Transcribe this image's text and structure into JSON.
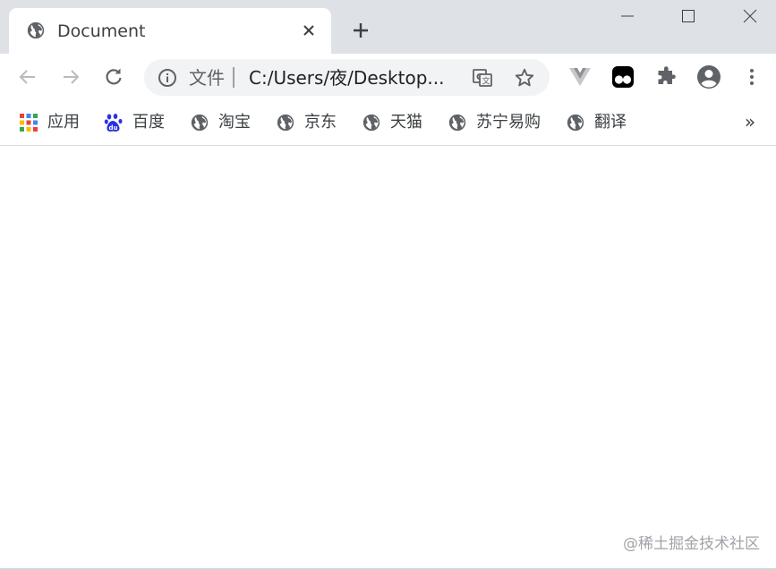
{
  "tab": {
    "title": "Document",
    "favicon": "globe-icon",
    "close_icon": "close-icon"
  },
  "new_tab_icon": "plus-icon",
  "window_controls": [
    "minimize-icon",
    "maximize-icon",
    "close-icon"
  ],
  "toolbar": {
    "back_icon": "back-arrow-icon",
    "forward_icon": "forward-arrow-icon",
    "reload_icon": "reload-icon",
    "extensions": [
      "vue-devtools-icon",
      "tampermonkey-icon",
      "puzzle-icon"
    ],
    "profile_icon": "account-icon",
    "menu_icon": "kebab-menu-icon"
  },
  "omnibox": {
    "scheme_label": "文件",
    "url": "C:/Users/夜/Desktop...",
    "info_icon": "info-icon",
    "translate_icon": "translate-icon",
    "bookmark_icon": "star-icon"
  },
  "bookmarks": [
    {
      "label": "应用",
      "icon": "apps-grid-icon"
    },
    {
      "label": "百度",
      "icon": "baidu-paw-icon"
    },
    {
      "label": "淘宝",
      "icon": "globe-icon"
    },
    {
      "label": "京东",
      "icon": "globe-icon"
    },
    {
      "label": "天猫",
      "icon": "globe-icon"
    },
    {
      "label": "苏宁易购",
      "icon": "globe-icon"
    },
    {
      "label": "翻译",
      "icon": "globe-icon"
    }
  ],
  "bookmarks_more": "»",
  "watermark": "@稀土掘金技术社区",
  "colors": {
    "tabstrip": "#dee1e6",
    "omnibox": "#f1f3f4",
    "icon": "#5f6368",
    "baidu_blue": "#2932e1"
  }
}
